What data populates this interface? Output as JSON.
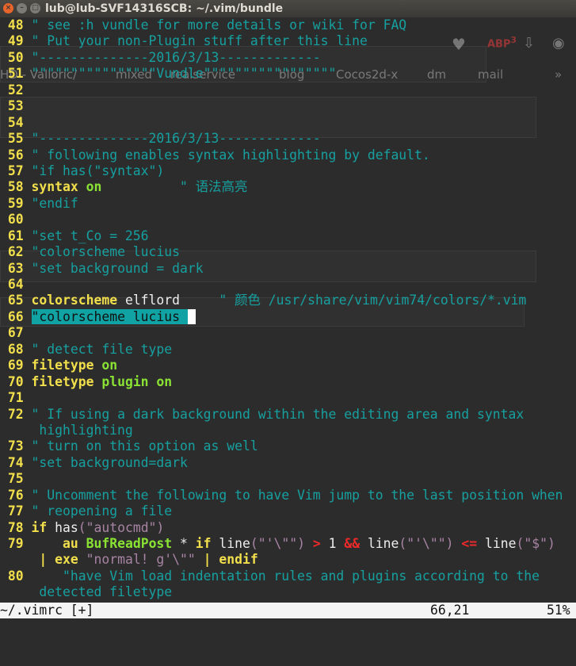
{
  "window": {
    "title": "lub@lub-SVF14316SCB: ~/.vim/bundle",
    "buttons": [
      "×",
      "–",
      "□"
    ]
  },
  "background_browser": {
    "bookmarks": [
      "HD - Valloric/",
      "mixed",
      "realservice",
      "blog",
      "Cocos2d-x",
      "dm",
      "mail",
      "»"
    ],
    "badge": "3"
  },
  "colors": {
    "line_number": "#f2df4c",
    "comment": "#17a0a0",
    "keyword": "#f2df4c",
    "string": "#a884a4",
    "constant": "#8ae234",
    "operator": "#ef2929",
    "cursorline": "#11a3a3"
  },
  "lines": [
    {
      "n": "48",
      "s": [
        [
          "cm",
          "\" see :h vundle for more details or wiki for FAQ"
        ]
      ]
    },
    {
      "n": "49",
      "s": [
        [
          "cm",
          "\" Put your non-Plugin stuff after this line"
        ]
      ]
    },
    {
      "n": "50",
      "s": [
        [
          "cm",
          "\"--------------2016/3/13-------------"
        ]
      ]
    },
    {
      "n": "51",
      "s": [
        [
          "cm",
          "\"\"\"\"\"\"\"\"\"\"\"\"\"\"\"\"Vundle\"\"\"\"\"\"\"\"\"\"\"\"\"\"\"\"\""
        ]
      ]
    },
    {
      "n": "52",
      "s": []
    },
    {
      "n": "53",
      "s": []
    },
    {
      "n": "54",
      "s": []
    },
    {
      "n": "55",
      "s": [
        [
          "cm",
          "\"--------------2016/3/13-------------"
        ]
      ]
    },
    {
      "n": "56",
      "s": [
        [
          "cm",
          "\" following enables syntax highlighting by default."
        ]
      ]
    },
    {
      "n": "57",
      "s": [
        [
          "cm",
          "\"if has(\"syntax\")"
        ]
      ]
    },
    {
      "n": "58",
      "s": [
        [
          "kw",
          "syntax"
        ],
        [
          "wh",
          " "
        ],
        [
          "gr",
          "on"
        ],
        [
          "wh",
          "          "
        ],
        [
          "cm",
          "\" 语法高亮"
        ]
      ]
    },
    {
      "n": "59",
      "s": [
        [
          "cm",
          "\"endif"
        ]
      ]
    },
    {
      "n": "60",
      "s": []
    },
    {
      "n": "61",
      "s": [
        [
          "cm",
          "\"set t_Co = 256"
        ]
      ]
    },
    {
      "n": "62",
      "s": [
        [
          "cm",
          "\"colorscheme lucius"
        ]
      ]
    },
    {
      "n": "63",
      "s": [
        [
          "cm",
          "\"set background = dark"
        ]
      ]
    },
    {
      "n": "64",
      "s": []
    },
    {
      "n": "65",
      "s": [
        [
          "kw",
          "colorscheme"
        ],
        [
          "wh",
          " elflord     "
        ],
        [
          "cm",
          "\" 颜色 /usr/share/vim/vim74/colors/*.vim"
        ]
      ]
    },
    {
      "n": "66",
      "s": [
        [
          "cur",
          "\"colorscheme lucius "
        ],
        [
          "cursor",
          " "
        ]
      ]
    },
    {
      "n": "67",
      "s": []
    },
    {
      "n": "68",
      "s": [
        [
          "cm",
          "\" detect file type"
        ]
      ]
    },
    {
      "n": "69",
      "s": [
        [
          "kw",
          "filetype"
        ],
        [
          "wh",
          " "
        ],
        [
          "gr",
          "on"
        ]
      ]
    },
    {
      "n": "70",
      "s": [
        [
          "kw",
          "filetype"
        ],
        [
          "wh",
          " "
        ],
        [
          "gr",
          "plugin on"
        ]
      ]
    },
    {
      "n": "71",
      "s": []
    },
    {
      "n": "72",
      "s": [
        [
          "cm",
          "\" If using a dark background within the editing area and syntax"
        ]
      ]
    },
    {
      "n": "",
      "s": [
        [
          "cm",
          "highlighting"
        ]
      ]
    },
    {
      "n": "73",
      "s": [
        [
          "cm",
          "\" turn on this option as well"
        ]
      ]
    },
    {
      "n": "74",
      "s": [
        [
          "cm",
          "\"set background=dark"
        ]
      ]
    },
    {
      "n": "75",
      "s": []
    },
    {
      "n": "76",
      "s": [
        [
          "cm",
          "\" Uncomment the following to have Vim jump to the last position when"
        ]
      ]
    },
    {
      "n": "77",
      "s": [
        [
          "cm",
          "\" reopening a file"
        ]
      ]
    },
    {
      "n": "78",
      "s": [
        [
          "kw",
          "if"
        ],
        [
          "wh",
          " has"
        ],
        [
          "st",
          "(\"autocmd\")"
        ]
      ]
    },
    {
      "n": "79",
      "s": [
        [
          "wh",
          "    "
        ],
        [
          "kw",
          "au"
        ],
        [
          "wh",
          " "
        ],
        [
          "gr",
          "BufReadPost"
        ],
        [
          "wh",
          " * "
        ],
        [
          "kw",
          "if"
        ],
        [
          "wh",
          " line"
        ],
        [
          "st",
          "(\"'\\\"\")"
        ],
        [
          "wh",
          " "
        ],
        [
          "rd",
          ">"
        ],
        [
          "wh",
          " 1 "
        ],
        [
          "rd",
          "&&"
        ],
        [
          "wh",
          " line"
        ],
        [
          "st",
          "(\"'\\\"\")"
        ],
        [
          "wh",
          " "
        ],
        [
          "rd",
          "<="
        ],
        [
          "wh",
          " line"
        ],
        [
          "st",
          "(\"$\")"
        ]
      ]
    },
    {
      "n": "",
      "s": [
        [
          "kw",
          "|"
        ],
        [
          "wh",
          " "
        ],
        [
          "kw",
          "exe"
        ],
        [
          "wh",
          " "
        ],
        [
          "st",
          "\"normal! g'\\\"\""
        ],
        [
          "wh",
          " "
        ],
        [
          "kw",
          "|"
        ],
        [
          "wh",
          " "
        ],
        [
          "kw",
          "endif"
        ]
      ]
    },
    {
      "n": "80",
      "s": [
        [
          "wh",
          "    "
        ],
        [
          "cm",
          "\"have Vim load indentation rules and plugins according to the"
        ]
      ]
    },
    {
      "n": "",
      "s": [
        [
          "cm",
          "detected filetype"
        ]
      ]
    }
  ],
  "status": {
    "file": "~/.vimrc [+]",
    "position": "66,21",
    "percent": "51%"
  }
}
